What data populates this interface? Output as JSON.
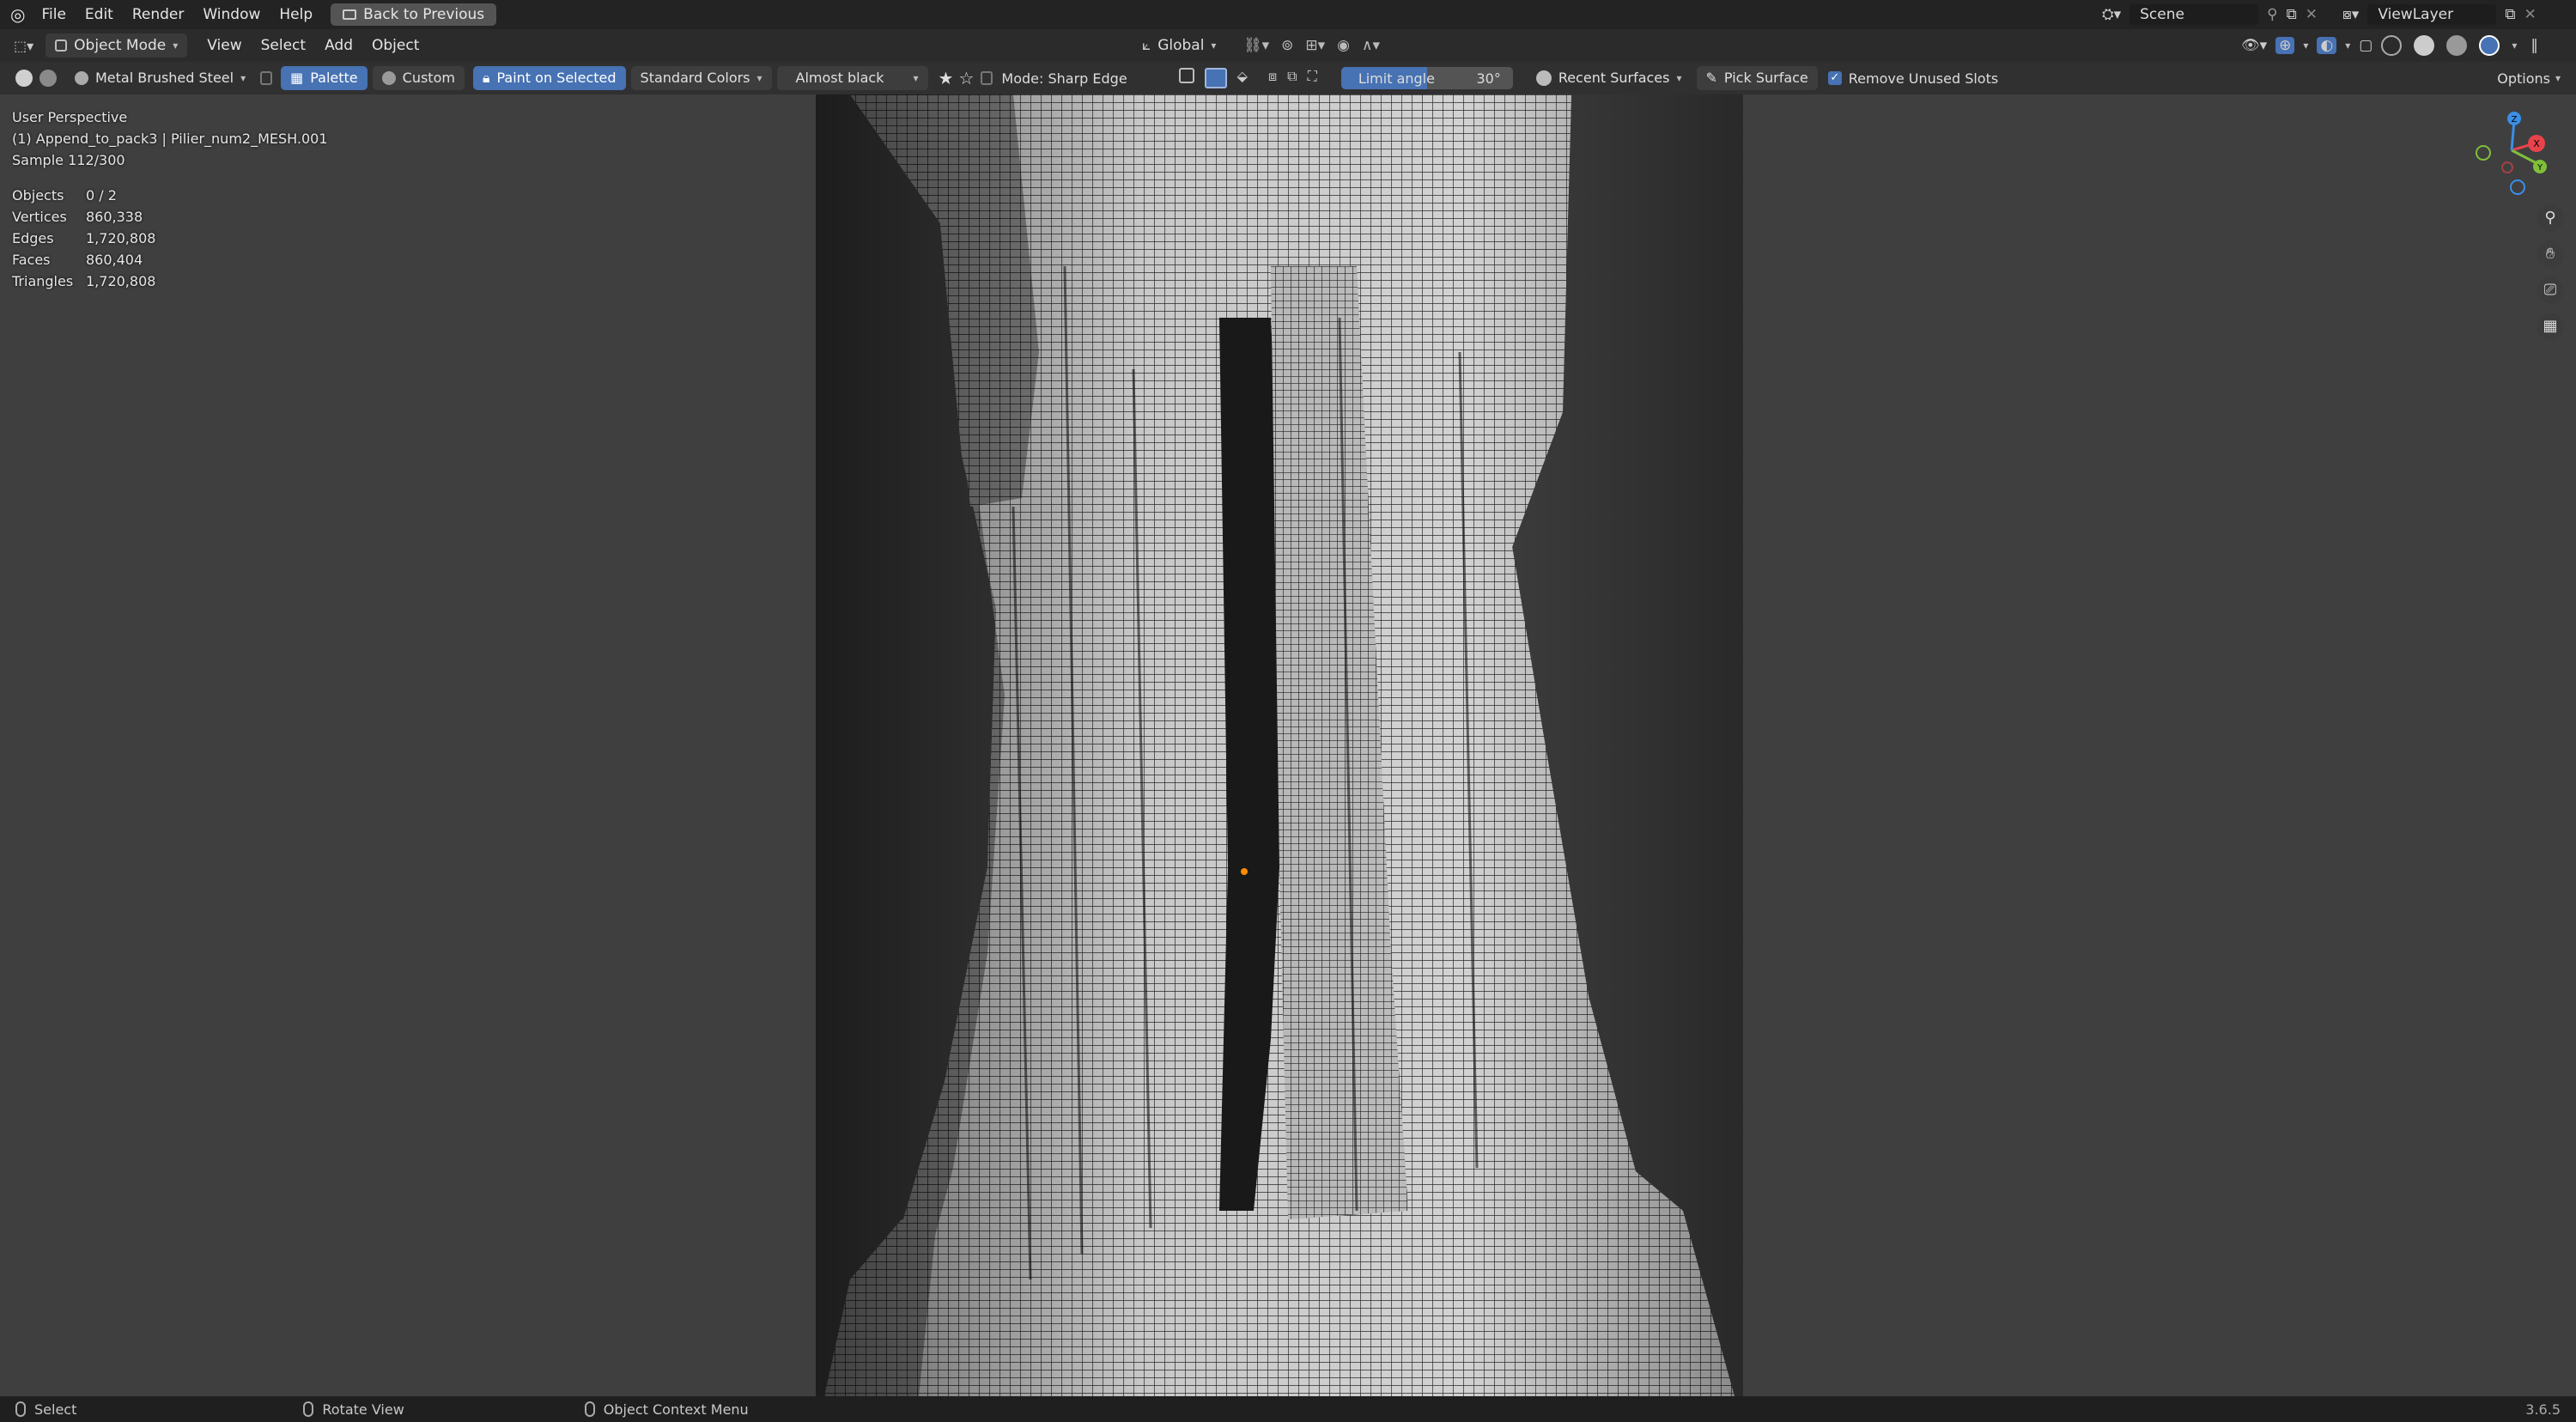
{
  "topbar": {
    "menus": [
      "File",
      "Edit",
      "Render",
      "Window",
      "Help"
    ],
    "back_button": "Back to Previous",
    "scene": "Scene",
    "view_layer": "ViewLayer"
  },
  "header": {
    "mode": "Object Mode",
    "menus": [
      "View",
      "Select",
      "Add",
      "Object"
    ],
    "transform_orientation": "Global"
  },
  "toolbar": {
    "material": "Metal Brushed Steel",
    "palette": "Palette",
    "custom": "Custom",
    "paint_on_selected": "Paint on Selected",
    "color_set": "Standard Colors",
    "color": "Almost black",
    "mode_label": "Mode: Sharp Edge",
    "limit_angle_label": "Limit angle",
    "limit_angle_value": "30°",
    "recent_surfaces": "Recent Surfaces",
    "pick_surface": "Pick Surface",
    "remove_unused_slots": "Remove Unused Slots",
    "remove_unused_checked": true,
    "options": "Options"
  },
  "viewport": {
    "perspective": "User Perspective",
    "object_info": "(1) Append_to_pack3 | Pilier_num2_MESH.001",
    "sample": "Sample 112/300",
    "stats": [
      {
        "label": "Objects",
        "value": "0 / 2"
      },
      {
        "label": "Vertices",
        "value": "860,338"
      },
      {
        "label": "Edges",
        "value": "1,720,808"
      },
      {
        "label": "Faces",
        "value": "860,404"
      },
      {
        "label": "Triangles",
        "value": "1,720,808"
      }
    ],
    "gizmo": {
      "x": "X",
      "y": "Y",
      "z": "Z"
    }
  },
  "statusbar": {
    "select": "Select",
    "rotate": "Rotate View",
    "context": "Object Context Menu",
    "version": "3.6.5"
  },
  "colors": {
    "accent": "#4772b3",
    "viewport_bg": "#3f3f3f",
    "x_axis": "#e8434b",
    "y_axis": "#7fbf3a",
    "z_axis": "#3b8ee8"
  }
}
